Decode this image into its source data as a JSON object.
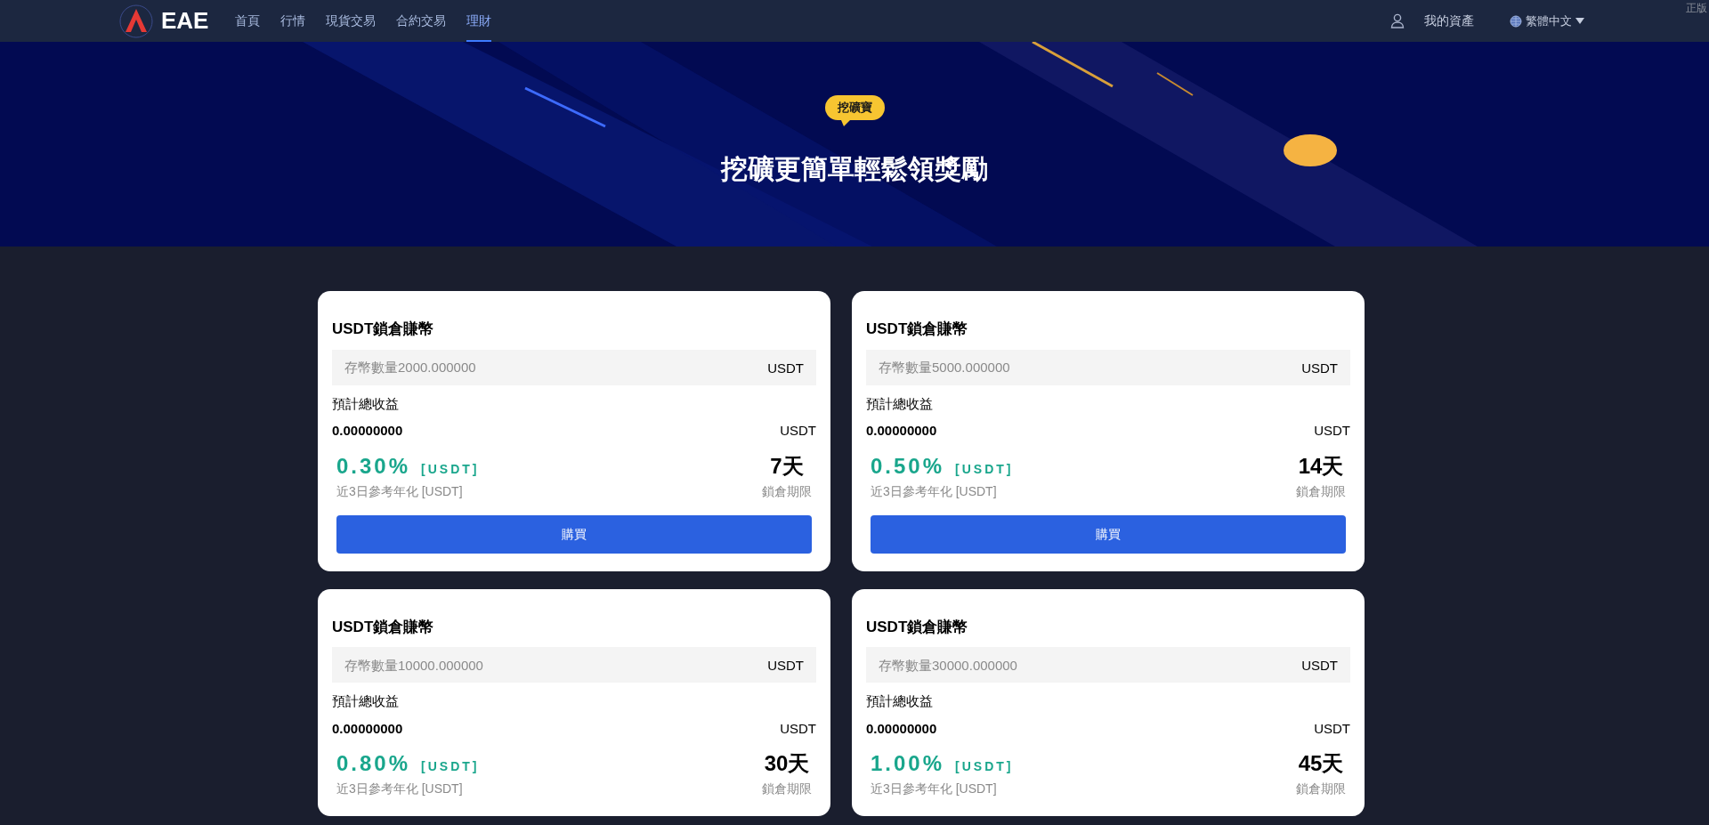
{
  "header": {
    "logo": "EAE",
    "nav": [
      {
        "label": "首頁",
        "selected": false
      },
      {
        "label": "行情",
        "selected": false
      },
      {
        "label": "現貨交易",
        "selected": false
      },
      {
        "label": "合約交易",
        "selected": false
      },
      {
        "label": "理財",
        "selected": true
      }
    ],
    "assets_link": "我的資產",
    "language": "繁體中文",
    "corner_text": "正版"
  },
  "banner": {
    "badge": "挖礦寶",
    "headline": "挖礦更簡單輕鬆領獎勵"
  },
  "cards": [
    {
      "title": "USDT鎖倉賺幣",
      "placeholder": "存幣數量2000.000000",
      "unit": "USDT",
      "income_label": "預計總收益",
      "income": "0.00000000",
      "income_unit": "USDT",
      "rate": "0.30%",
      "rate_unit": "[USDT]",
      "rate_label": "近3日參考年化 [USDT]",
      "term": "7天",
      "term_label": "鎖倉期限",
      "buy_button": "購買"
    },
    {
      "title": "USDT鎖倉賺幣",
      "placeholder": "存幣數量5000.000000",
      "unit": "USDT",
      "income_label": "預計總收益",
      "income": "0.00000000",
      "income_unit": "USDT",
      "rate": "0.50%",
      "rate_unit": "[USDT]",
      "rate_label": "近3日參考年化 [USDT]",
      "term": "14天",
      "term_label": "鎖倉期限",
      "buy_button": "購買"
    },
    {
      "title": "USDT鎖倉賺幣",
      "placeholder": "存幣數量10000.000000",
      "unit": "USDT",
      "income_label": "預計總收益",
      "income": "0.00000000",
      "income_unit": "USDT",
      "rate": "0.80%",
      "rate_unit": "[USDT]",
      "rate_label": "近3日參考年化 [USDT]",
      "term": "30天",
      "term_label": "鎖倉期限"
    },
    {
      "title": "USDT鎖倉賺幣",
      "placeholder": "存幣數量30000.000000",
      "unit": "USDT",
      "income_label": "預計總收益",
      "income": "0.00000000",
      "income_unit": "USDT",
      "rate": "1.00%",
      "rate_unit": "[USDT]",
      "rate_label": "近3日參考年化 [USDT]",
      "term": "45天",
      "term_label": "鎖倉期限"
    }
  ]
}
